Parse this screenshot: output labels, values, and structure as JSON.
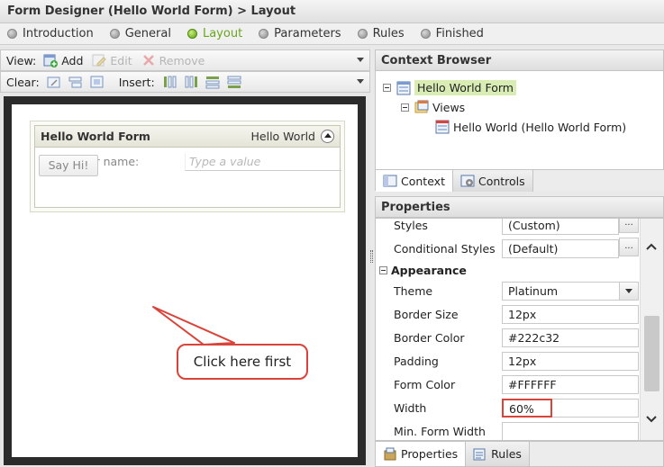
{
  "title": "Form Designer (Hello World Form) > Layout",
  "wizard_steps": [
    {
      "label": "Introduction",
      "active": false
    },
    {
      "label": "General",
      "active": false
    },
    {
      "label": "Layout",
      "active": true
    },
    {
      "label": "Parameters",
      "active": false
    },
    {
      "label": "Rules",
      "active": false
    },
    {
      "label": "Finished",
      "active": false
    }
  ],
  "toolbar": {
    "view_label": "View:",
    "add_label": "Add",
    "edit_label": "Edit",
    "remove_label": "Remove",
    "clear_label": "Clear:",
    "insert_label": "Insert:"
  },
  "form": {
    "title": "Hello World Form",
    "subtitle": "Hello World",
    "name_label": "Enter your name:",
    "name_placeholder": "Type a value",
    "button_label": "Say Hi!"
  },
  "callout": "Click here first",
  "context_browser": {
    "title": "Context Browser",
    "root": "Hello World Form",
    "views": "Views",
    "view_item": "Hello World (Hello World Form)",
    "tabs": [
      "Context",
      "Controls"
    ]
  },
  "properties": {
    "title": "Properties",
    "rows_top": [
      {
        "name": "Styles",
        "value": "(Custom)"
      },
      {
        "name": "Conditional Styles",
        "value": "(Default)"
      }
    ],
    "section": "Appearance",
    "rows": [
      {
        "name": "Theme",
        "value": "Platinum"
      },
      {
        "name": "Border Size",
        "value": "12px"
      },
      {
        "name": "Border Color",
        "value": "#222c32"
      },
      {
        "name": "Padding",
        "value": "12px"
      },
      {
        "name": "Form Color",
        "value": "#FFFFFF"
      },
      {
        "name": "Width",
        "value": "60%"
      },
      {
        "name": "Min. Form Width",
        "value": ""
      }
    ],
    "tabs": [
      "Properties",
      "Rules"
    ]
  },
  "colors": {
    "accent_green": "#6aa520",
    "highlight_red": "#d9433a"
  }
}
